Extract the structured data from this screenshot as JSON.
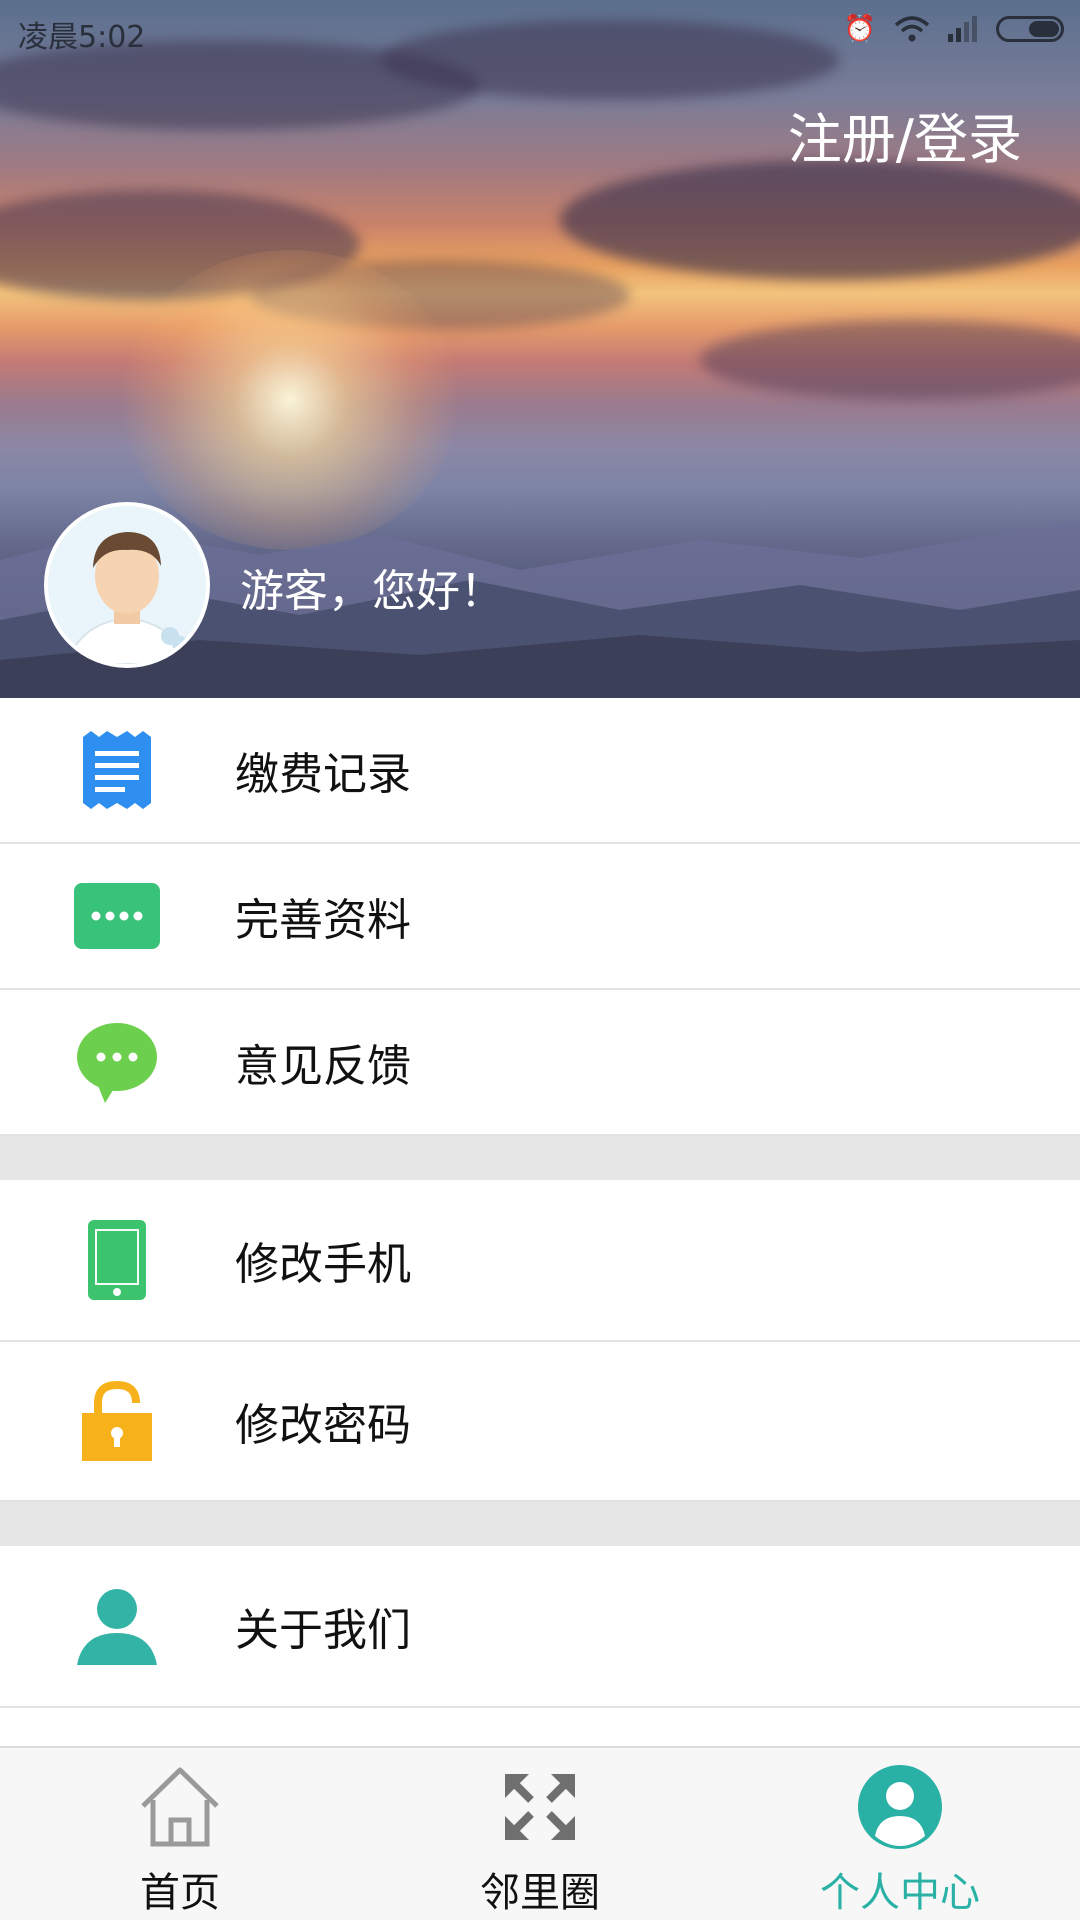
{
  "status_bar": {
    "time": "凌晨5:02"
  },
  "header": {
    "login_label": "注册/登录",
    "greeting": "游客，您好！"
  },
  "menu": {
    "items": [
      {
        "label": "缴费记录",
        "icon": "receipt-icon",
        "color": "#2f8ff0"
      },
      {
        "label": "完善资料",
        "icon": "password-dots-icon",
        "color": "#39c27a"
      },
      {
        "label": "意见反馈",
        "icon": "chat-bubble-icon",
        "color": "#6dcf4e"
      },
      {
        "label": "修改手机",
        "icon": "phone-icon",
        "color": "#3bc36d"
      },
      {
        "label": "修改密码",
        "icon": "lock-icon",
        "color": "#f7b21b"
      },
      {
        "label": "关于我们",
        "icon": "person-icon",
        "color": "#32b3a6"
      }
    ]
  },
  "tabbar": {
    "tabs": [
      {
        "label": "首页",
        "icon": "home-icon"
      },
      {
        "label": "邻里圈",
        "icon": "arrows-icon"
      },
      {
        "label": "个人中心",
        "icon": "profile-icon",
        "active": true
      }
    ],
    "active_color": "#2ab1a6"
  }
}
